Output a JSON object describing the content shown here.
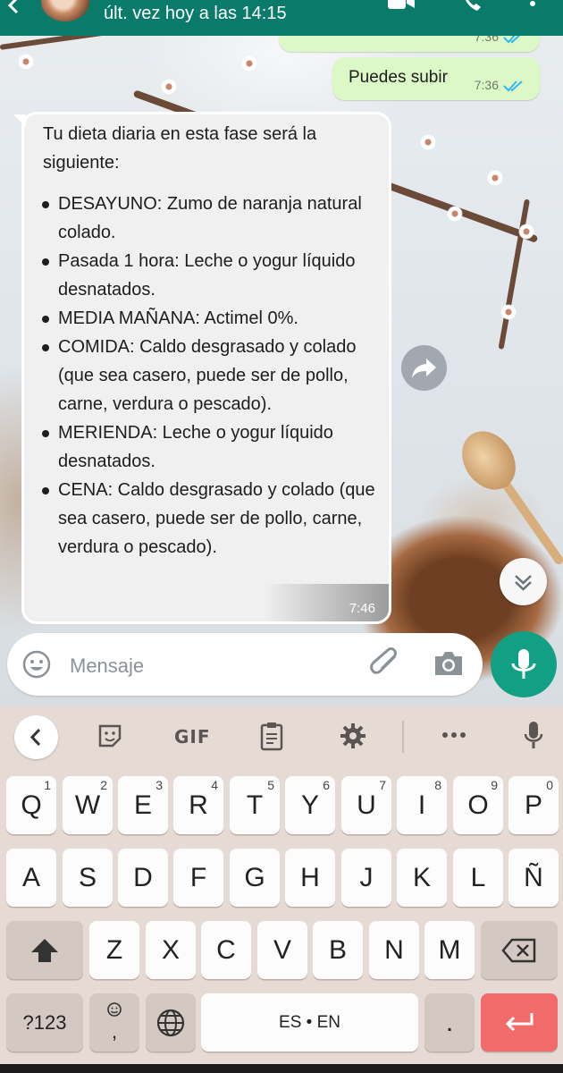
{
  "header": {
    "status": "últ. vez hoy a las 14:15",
    "icons": [
      "back-arrow-icon",
      "avatar",
      "video-call-icon",
      "phone-call-icon",
      "more-vert-icon"
    ]
  },
  "chat": {
    "messages_out": [
      {
        "text": "",
        "time": "7:36"
      },
      {
        "text": "Puedes subir",
        "time": "7:36"
      }
    ],
    "message_in": {
      "intro": "Tu dieta diaria en esta fase será la siguiente:",
      "items": [
        "DESAYUNO: Zumo de naranja natural colado.",
        "Pasada 1 hora: Leche o yogur líquido desnatados.",
        "MEDIA MAÑANA: Actimel 0%.",
        "COMIDA: Caldo desgrasado y colado (que sea casero, puede ser de pollo, carne, verdura o pescado).",
        "MERIENDA: Leche o yogur líquido desnatados.",
        "CENA: Caldo desgrasado y colado (que sea casero, puede ser de pollo, carne, verdura o pescado)."
      ],
      "time": "7:46"
    }
  },
  "composer": {
    "placeholder": "Mensaje",
    "icons": [
      "emoji-icon",
      "attach-icon",
      "camera-icon",
      "mic-icon"
    ]
  },
  "keyboard": {
    "toolbar": {
      "gif_label": "GIF",
      "icons": [
        "chevron-left-icon",
        "sticker-icon",
        "clipboard-icon",
        "gear-icon",
        "more-horiz-icon",
        "mic-icon"
      ]
    },
    "row1": [
      {
        "key": "Q",
        "hint": "1"
      },
      {
        "key": "W",
        "hint": "2"
      },
      {
        "key": "E",
        "hint": "3"
      },
      {
        "key": "R",
        "hint": "4"
      },
      {
        "key": "T",
        "hint": "5"
      },
      {
        "key": "Y",
        "hint": "6"
      },
      {
        "key": "U",
        "hint": "7"
      },
      {
        "key": "I",
        "hint": "8"
      },
      {
        "key": "O",
        "hint": "9"
      },
      {
        "key": "P",
        "hint": "0"
      }
    ],
    "row2": [
      "A",
      "S",
      "D",
      "F",
      "G",
      "H",
      "J",
      "K",
      "L",
      "Ñ"
    ],
    "row3": [
      "Z",
      "X",
      "C",
      "V",
      "B",
      "N",
      "M"
    ],
    "row4": {
      "symbols": "?123",
      "emoji_comma": ",",
      "space": "ES • EN",
      "period": "."
    },
    "colors": {
      "background": "#e6dad5",
      "enter": "#f16b6b",
      "key": "#fcfcfc"
    }
  },
  "colors": {
    "header": "#0a7a6a",
    "outgoing": "#dcf8c6",
    "incoming": "#f0f0f0",
    "mic": "#12a084",
    "read_ticks": "#34b7f1"
  }
}
